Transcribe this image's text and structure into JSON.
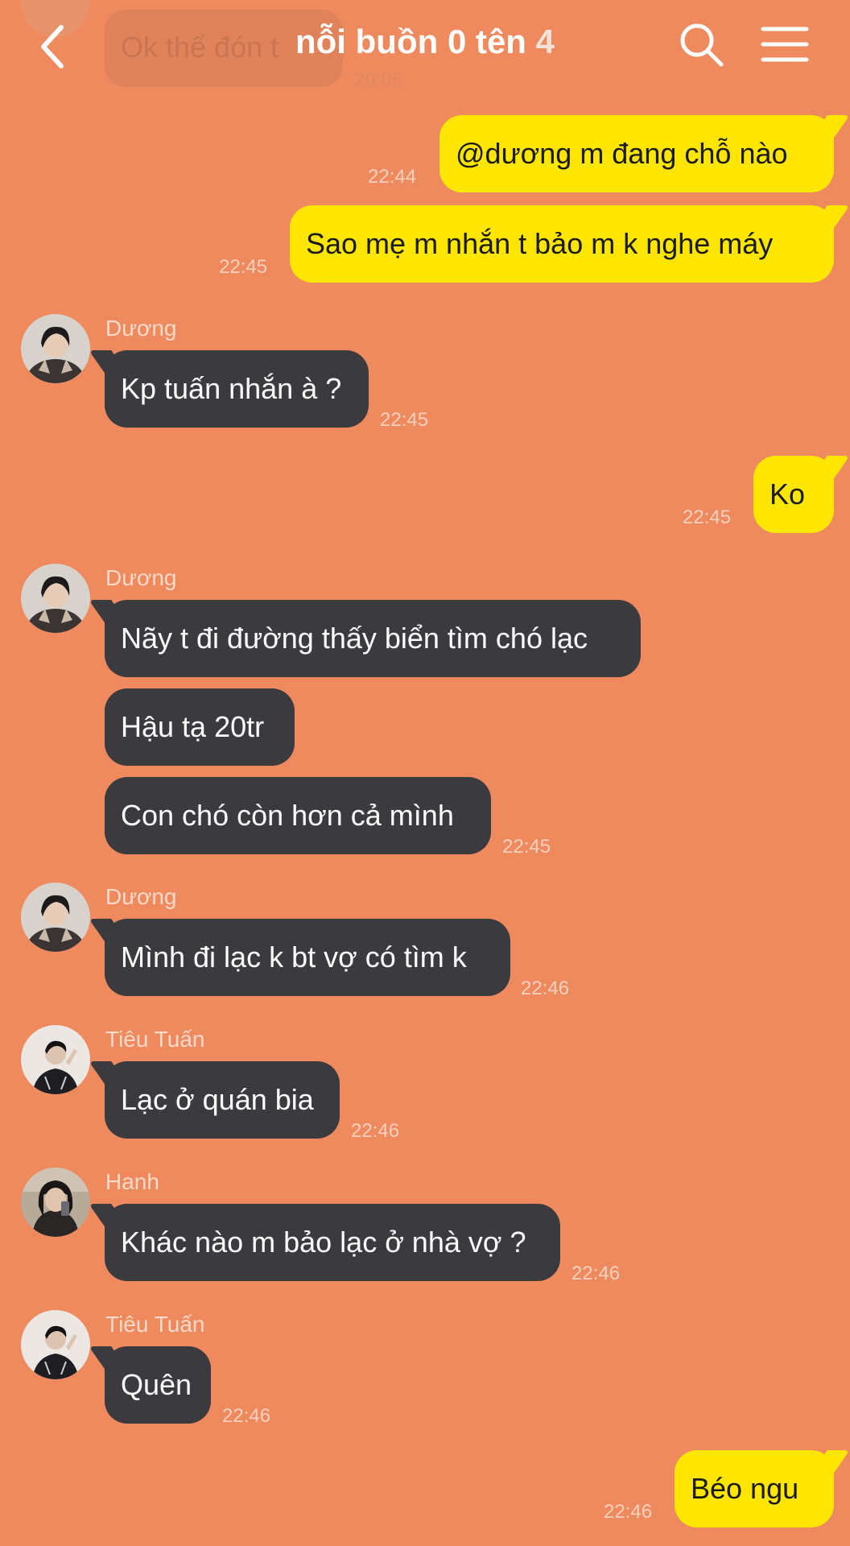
{
  "header": {
    "title": "nỗi buồn 0 tên",
    "member_count": "4",
    "faded_prev_text": "Ok thế đón t",
    "faded_prev_time": "20:06"
  },
  "icons": {
    "back": "chevron-left-icon",
    "search": "search-icon",
    "menu": "hamburger-menu-icon"
  },
  "colors": {
    "background": "#EF8A5E",
    "outgoing_bubble": "#FFE600",
    "incoming_bubble": "#3B3B3F",
    "time_text": "#f6d1bf"
  },
  "messages": [
    {
      "dir": "out",
      "text": "@dương m đang chỗ nào",
      "time": "22:44"
    },
    {
      "dir": "out",
      "text": "Sao mẹ m nhắn t bảo m k nghe máy",
      "time": "22:45"
    },
    {
      "dir": "in",
      "sender": "Dương",
      "text": "Kp tuấn nhắn à ?",
      "time": "22:45"
    },
    {
      "dir": "out",
      "text": "Ko",
      "time": "22:45"
    },
    {
      "dir": "in",
      "sender": "Dương",
      "text": "Nãy t đi đường thấy biển tìm chó lạc"
    },
    {
      "dir": "in",
      "text": "Hậu tạ 20tr"
    },
    {
      "dir": "in",
      "text": "Con chó còn hơn cả mình",
      "time": "22:45"
    },
    {
      "dir": "in",
      "sender": "Dương",
      "text": "Mình đi lạc k bt vợ có tìm k",
      "time": "22:46"
    },
    {
      "dir": "in",
      "sender": "Tiêu Tuấn",
      "text": "Lạc ở quán bia",
      "time": "22:46"
    },
    {
      "dir": "in",
      "sender": "Hanh",
      "text": "Khác nào m bảo lạc ở nhà vợ ?",
      "time": "22:46"
    },
    {
      "dir": "in",
      "sender": "Tiêu Tuấn",
      "text": "Quên",
      "time": "22:46"
    },
    {
      "dir": "out",
      "text": "Béo ngu",
      "time": "22:46"
    }
  ]
}
